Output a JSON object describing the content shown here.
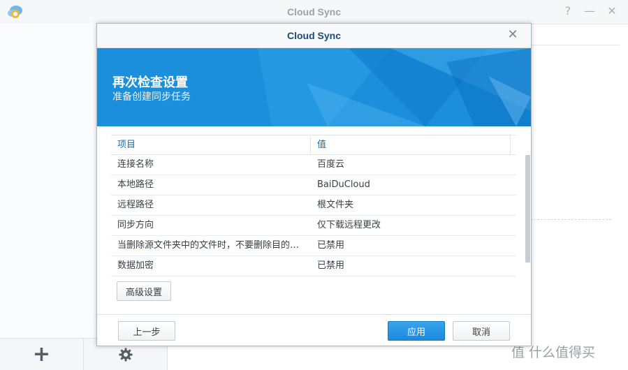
{
  "app": {
    "title": "Cloud Sync",
    "window_controls": [
      "?",
      "—",
      "✕"
    ],
    "bottom_add_label": "+",
    "watermark": "值 什么值得买"
  },
  "dialog": {
    "title": "Cloud Sync",
    "close_label": "✕",
    "banner": {
      "title": "再次检查设置",
      "subtitle": "准备创建同步任务",
      "color": "#1b8fdc"
    },
    "table": {
      "headers": [
        "项目",
        "值"
      ],
      "rows": [
        {
          "item": "连接名称",
          "value": "百度云"
        },
        {
          "item": "本地路径",
          "value": "BaiDuCloud"
        },
        {
          "item": "远程路径",
          "value": "根文件夹"
        },
        {
          "item": "同步方向",
          "value": "仅下载远程更改"
        },
        {
          "item": "当删除源文件夹中的文件时，不要删除目的地文…",
          "value": "已禁用"
        },
        {
          "item": "数据加密",
          "value": "已禁用"
        }
      ]
    },
    "buttons": {
      "advanced": "高级设置",
      "previous": "上一步",
      "apply": "应用",
      "cancel": "取消"
    },
    "accent_color": "#1a8ae0"
  }
}
